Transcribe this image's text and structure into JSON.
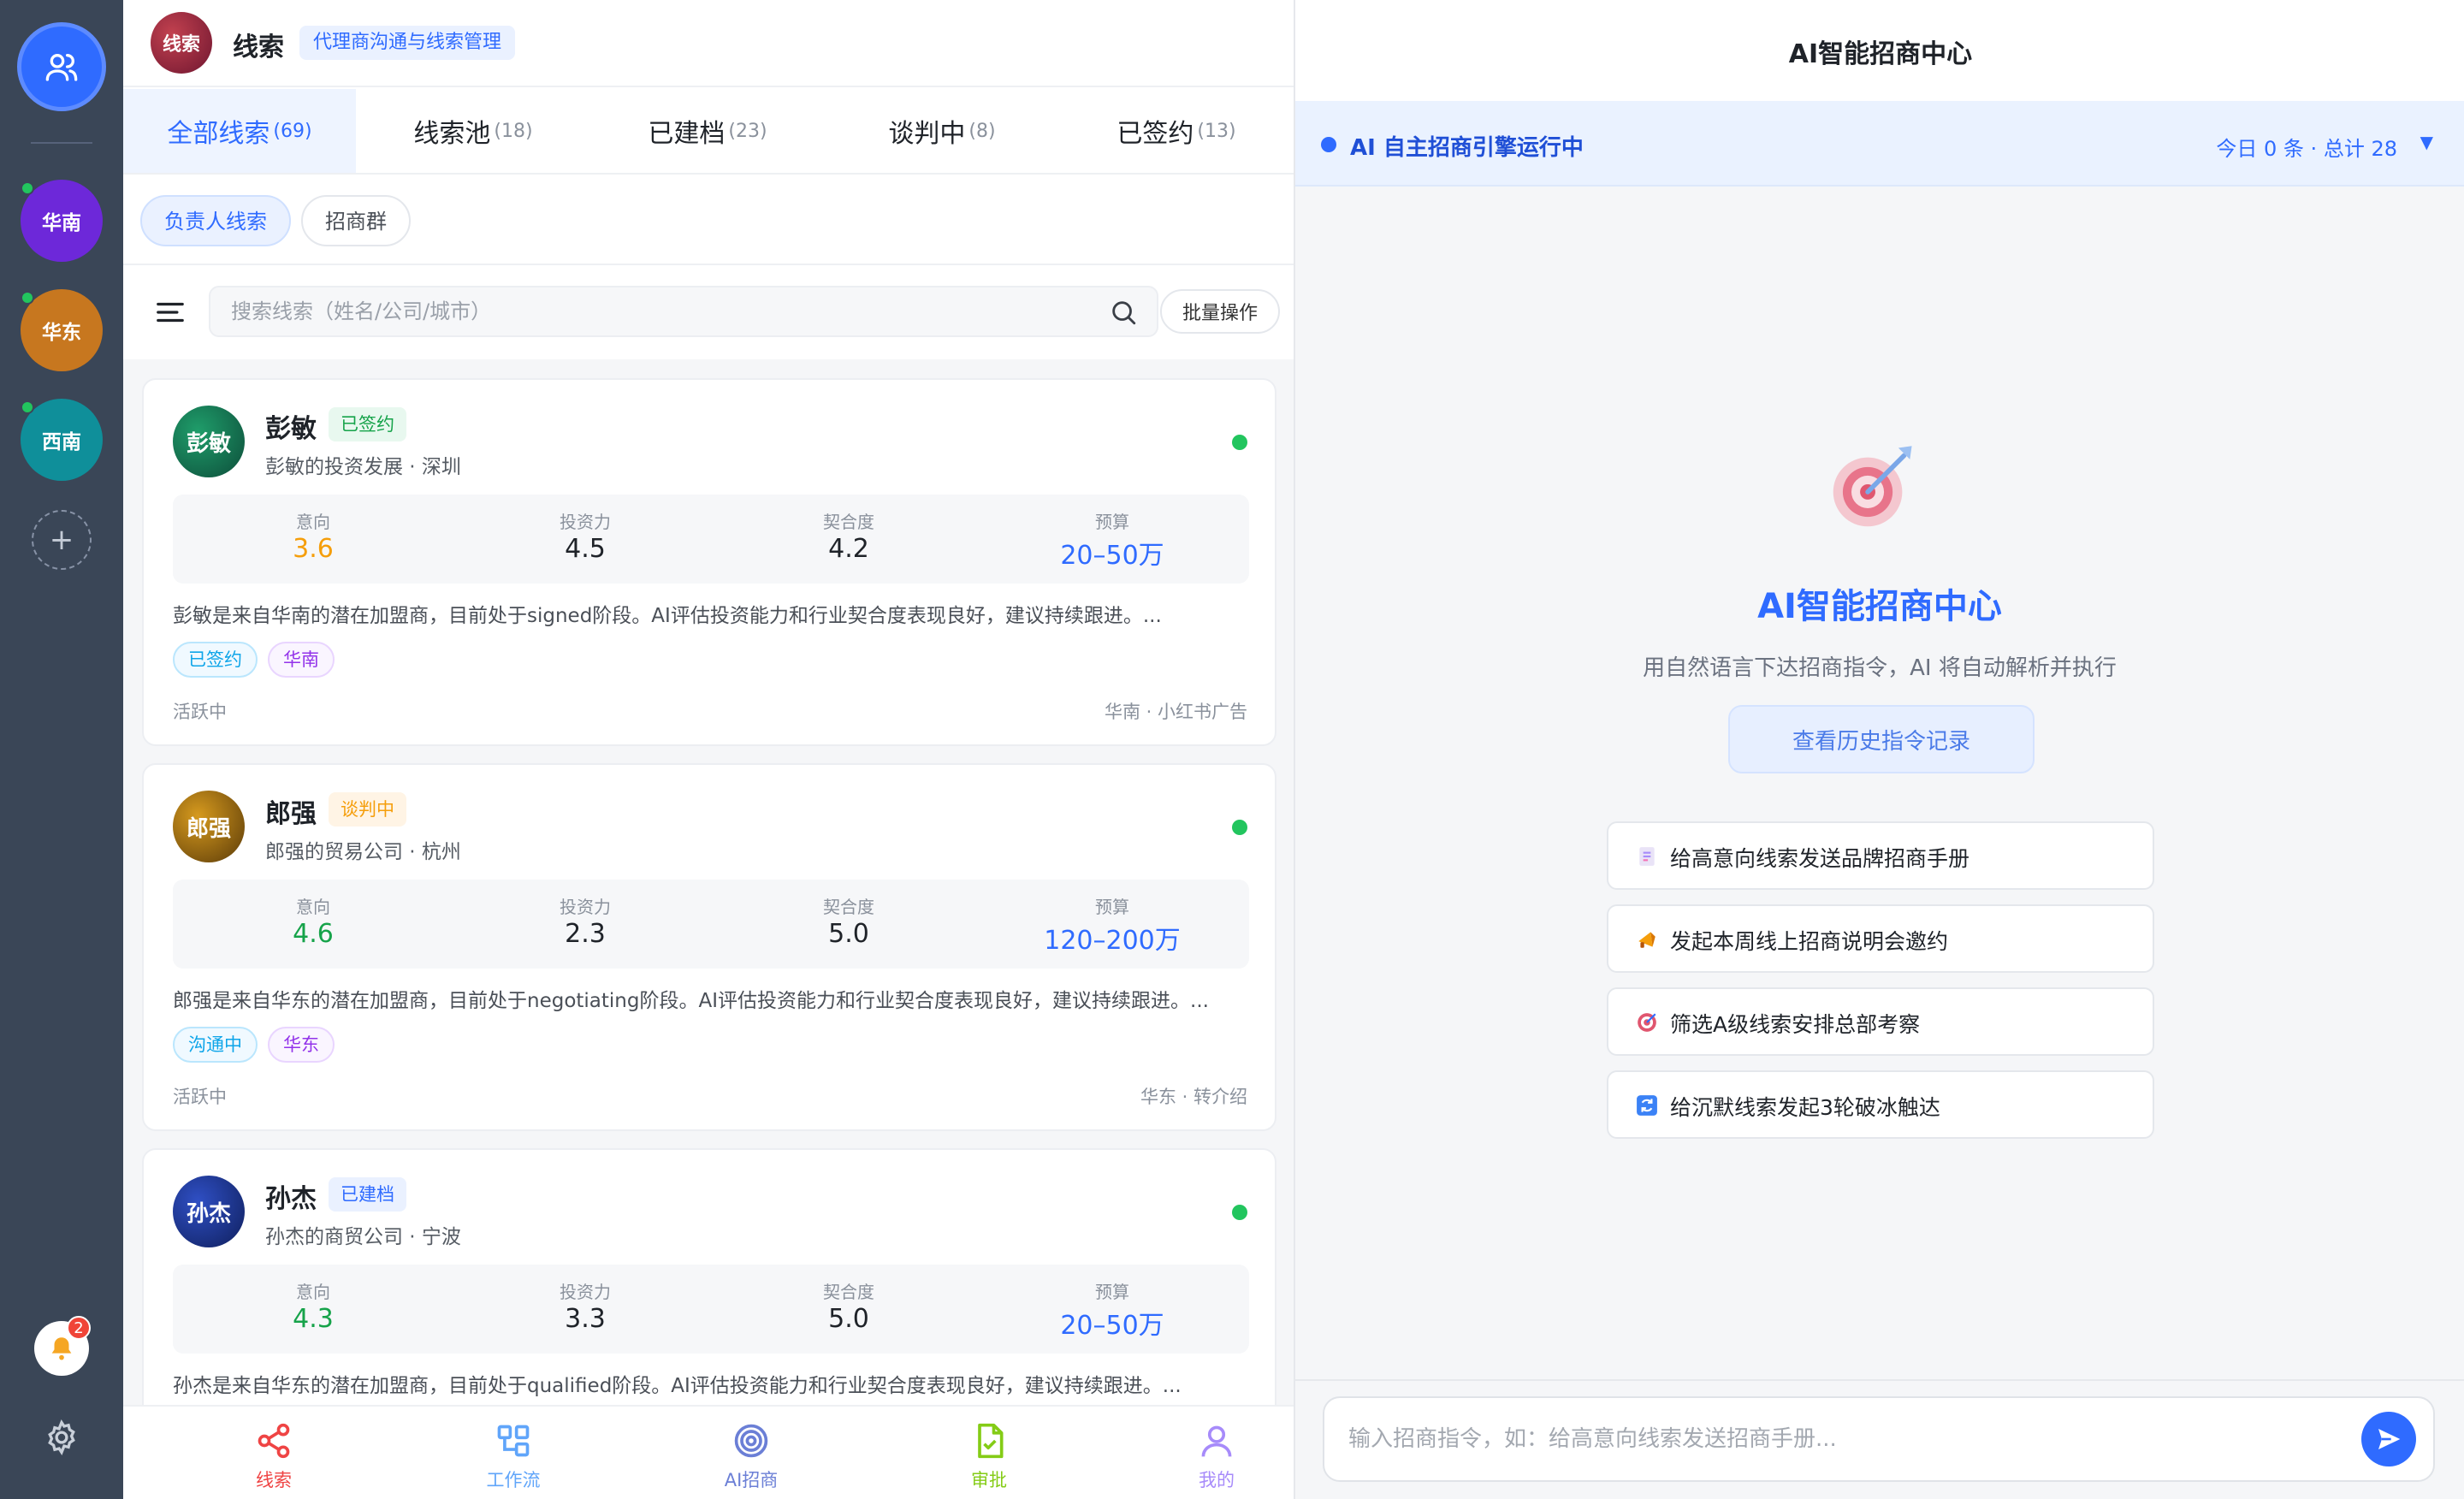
{
  "rail": {
    "regions": [
      {
        "label": "华南",
        "color": "#6d28d9"
      },
      {
        "label": "华东",
        "color": "#c7771f"
      },
      {
        "label": "西南",
        "color": "#0f8f9a"
      }
    ],
    "add_label": "+",
    "notification_count": "2"
  },
  "header": {
    "logo_text": "线索",
    "title": "线索",
    "subtitle": "代理商沟通与线索管理"
  },
  "tabs": [
    {
      "label": "全部线索",
      "count": "(69)"
    },
    {
      "label": "线索池",
      "count": "(18)"
    },
    {
      "label": "已建档",
      "count": "(23)"
    },
    {
      "label": "谈判中",
      "count": "(8)"
    },
    {
      "label": "已签约",
      "count": "(13)"
    }
  ],
  "subtabs": [
    "负责人线索",
    "招商群"
  ],
  "search": {
    "placeholder": "搜索线索（姓名/公司/城市）",
    "batch_label": "批量操作"
  },
  "metric_labels": [
    "意向",
    "投资力",
    "契合度",
    "预算"
  ],
  "leads": [
    {
      "avatar_text": "彭敏",
      "name": "彭敏",
      "status": "已签约",
      "company": "彭敏的投资发展 · 深圳",
      "metrics": [
        "3.6",
        "4.5",
        "4.2",
        "20–50万"
      ],
      "summary": "彭敏是来自华南的潜在加盟商，目前处于signed阶段。AI评估投资能力和行业契合度表现良好，建议持续跟进。...",
      "tags": [
        "已签约",
        "华南"
      ],
      "activity": "活跃中",
      "source": "华南 · 小红书广告"
    },
    {
      "avatar_text": "郎强",
      "name": "郎强",
      "status": "谈判中",
      "company": "郎强的贸易公司 · 杭州",
      "metrics": [
        "4.6",
        "2.3",
        "5.0",
        "120–200万"
      ],
      "summary": "郎强是来自华东的潜在加盟商，目前处于negotiating阶段。AI评估投资能力和行业契合度表现良好，建议持续跟进。...",
      "tags": [
        "沟通中",
        "华东"
      ],
      "activity": "活跃中",
      "source": "华东 · 转介绍"
    },
    {
      "avatar_text": "孙杰",
      "name": "孙杰",
      "status": "已建档",
      "company": "孙杰的商贸公司 · 宁波",
      "metrics": [
        "4.3",
        "3.3",
        "5.0",
        "20–50万"
      ],
      "summary": "孙杰是来自华东的潜在加盟商，目前处于qualified阶段。AI评估投资能力和行业契合度表现良好，建议持续跟进。...",
      "tags": [],
      "activity": "",
      "source": ""
    }
  ],
  "bottom_nav": [
    {
      "label": "线索",
      "icon": "share-icon",
      "color": "#ef4444"
    },
    {
      "label": "工作流",
      "icon": "workflow-icon",
      "color": "#60a5fa"
    },
    {
      "label": "AI招商",
      "icon": "target-icon",
      "color": "#6b7fd6"
    },
    {
      "label": "审批",
      "icon": "approve-doc-icon",
      "color": "#84cc16"
    },
    {
      "label": "我的",
      "icon": "user-icon",
      "color": "#a78bfa"
    }
  ],
  "right": {
    "title": "AI智能招商中心",
    "engine_status": "AI 自主招商引擎运行中",
    "engine_stats": "今日 0 条 · 总计 28",
    "hero_title": "AI智能招商中心",
    "hero_desc": "用自然语言下达招商指令，AI 将自动解析并执行",
    "history_label": "查看历史指令记录",
    "commands": [
      {
        "icon": "brochure-icon",
        "text": "给高意向线索发送品牌招商手册"
      },
      {
        "icon": "megaphone-icon",
        "text": "发起本周线上招商说明会邀约"
      },
      {
        "icon": "target-icon",
        "text": "筛选A级线索安排总部考察"
      },
      {
        "icon": "refresh-icon",
        "text": "给沉默线索发起3轮破冰触达"
      }
    ],
    "input_placeholder": "输入招商指令，如：给高意向线索发送招商手册..."
  }
}
